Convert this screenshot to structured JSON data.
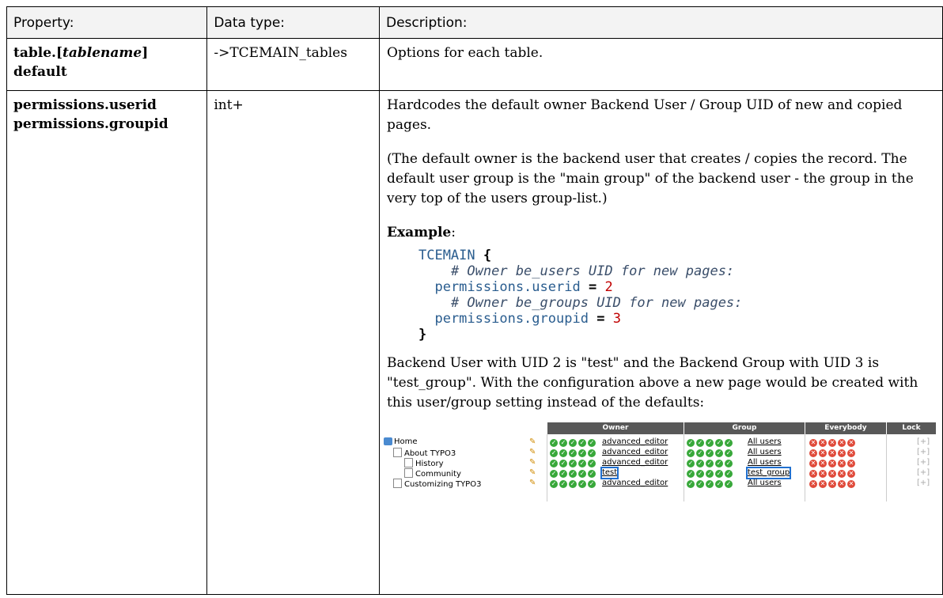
{
  "headers": {
    "property": "Property:",
    "datatype": "Data type:",
    "description": "Description:"
  },
  "rows": [
    {
      "prop_prefix": "table.[",
      "prop_italic": "tablename",
      "prop_suffix": "]",
      "prop_line2": "default",
      "datatype": "->TCEMAIN_tables",
      "description": "Options for each table."
    },
    {
      "prop_line1": "permissions.userid",
      "prop_line2": "permissions.groupid",
      "datatype": "int+",
      "desc_p1": "Hardcodes the default owner Backend User / Group UID of new and copied pages.",
      "desc_p2": "(The default owner is the backend user that creates / copies the record. The default user group is the \"main group\" of the backend user - the group in the very top of the users group-list.)",
      "example_label": "Example",
      "example_colon": ":",
      "code": {
        "l1_kw": "TCEMAIN",
        "l1_brace": "{",
        "l2_comment": "# Owner be_users UID for new pages:",
        "l3_key": "permissions.userid",
        "l3_eq": "=",
        "l3_val": "2",
        "l4_comment": "# Owner be_groups UID for new pages:",
        "l5_key": "permissions.groupid",
        "l5_eq": "=",
        "l5_val": "3",
        "l6_brace": "}"
      },
      "desc_p3": "Backend User with UID 2 is \"test\" and the Backend Group with UID 3 is \"test_group\". With the configuration above a new page would be created with this user/group setting instead of the defaults:"
    }
  ],
  "screenshot": {
    "col_headers": {
      "owner": "Owner",
      "group": "Group",
      "everybody": "Everybody",
      "lock": "Lock"
    },
    "pages": [
      {
        "title": "Home",
        "owner": "advanced_editor",
        "group": "All users",
        "lock": "[+]"
      },
      {
        "title": "About TYPO3",
        "owner": "advanced_editor",
        "group": "All users",
        "lock": "[+]"
      },
      {
        "title": "History",
        "owner": "advanced_editor",
        "group": "All users",
        "lock": "[+]"
      },
      {
        "title": "Community",
        "owner": "test",
        "group": "test_group",
        "lock": "[+]"
      },
      {
        "title": "Customizing TYPO3",
        "owner": "advanced_editor",
        "group": "All users",
        "lock": "[+]"
      }
    ],
    "colors": {
      "header_bg": "#585858",
      "check": "#38a83a",
      "cross": "#e04a3a",
      "highlight": "#2070d0"
    }
  }
}
